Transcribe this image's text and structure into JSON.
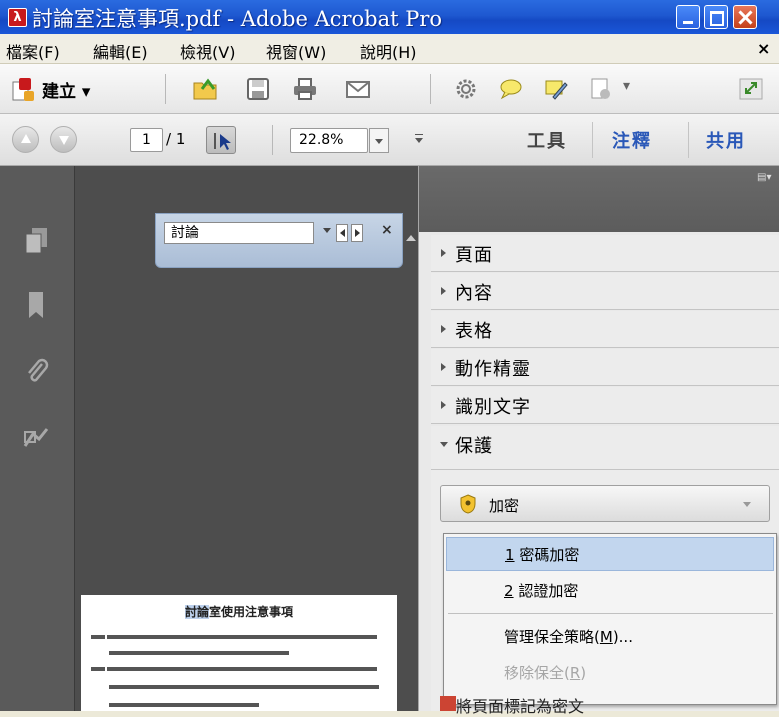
{
  "titlebar": {
    "title": "討論室注意事項.pdf - Adobe Acrobat Pro"
  },
  "menubar": {
    "items": [
      "檔案(F)",
      "編輯(E)",
      "檢視(V)",
      "視窗(W)",
      "說明(H)"
    ],
    "close_glyph": "×"
  },
  "toolbar": {
    "create_label": "建立 ▾",
    "icons": [
      "create-icon",
      "open-icon",
      "save-icon",
      "print-icon",
      "email-icon",
      "settings-icon",
      "comment-icon",
      "sign-icon",
      "export-icon"
    ]
  },
  "navbar": {
    "page_current": "1",
    "page_total": "/ 1",
    "zoom": "22.8%",
    "tabs": [
      "工具",
      "注釋",
      "共用"
    ]
  },
  "findbar": {
    "query": "討論",
    "close": "×"
  },
  "document": {
    "title_highlight": "討論",
    "title_rest": "室使用注意事項"
  },
  "rightpanel": {
    "sections": [
      {
        "label": "頁面",
        "expanded": false
      },
      {
        "label": "內容",
        "expanded": false
      },
      {
        "label": "表格",
        "expanded": false
      },
      {
        "label": "動作精靈",
        "expanded": false
      },
      {
        "label": "識別文字",
        "expanded": false
      },
      {
        "label": "保護",
        "expanded": true
      }
    ],
    "encrypt_label": "加密",
    "dropdown": {
      "item1_key": "1",
      "item1_label": " 密碼加密",
      "item2_key": "2",
      "item2_label": " 認證加密",
      "item3_label": "管理保全策略(",
      "item3_key": "M",
      "item3_suffix": ")...",
      "item4_label": "移除保全(",
      "item4_key": "R",
      "item4_suffix": ")"
    },
    "partial_row": "將頁面標記為密文"
  },
  "colors": {
    "titlebar": "#1e58d0",
    "accent_tab": "#2a58b8",
    "selection": "#c2d6ee"
  }
}
